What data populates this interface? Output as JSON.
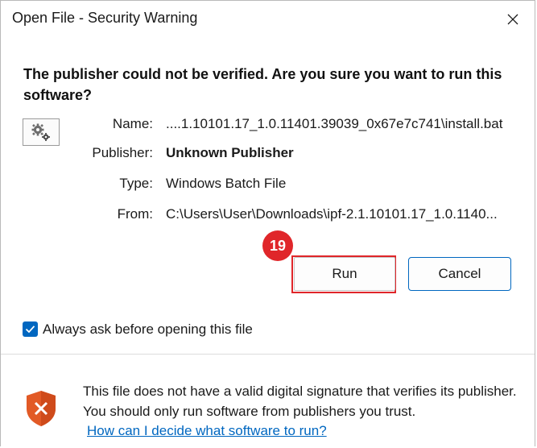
{
  "window": {
    "title": "Open File - Security Warning"
  },
  "warning": {
    "headline": "The publisher could not be verified.  Are you sure you want to run this software?"
  },
  "file_info": {
    "name_label": "Name:",
    "name_value": "....1.10101.17_1.0.11401.39039_0x67e7c741\\install.bat",
    "publisher_label": "Publisher:",
    "publisher_value": "Unknown Publisher",
    "type_label": "Type:",
    "type_value": "Windows Batch File",
    "from_label": "From:",
    "from_value": "C:\\Users\\User\\Downloads\\ipf-2.1.10101.17_1.0.1140..."
  },
  "actions": {
    "run_label": "Run",
    "cancel_label": "Cancel",
    "step_badge": "19"
  },
  "options": {
    "always_ask_label": "Always ask before opening this file",
    "always_ask_checked": true
  },
  "footer": {
    "message": "This file does not have a valid digital signature that verifies its publisher.  You should only run software from publishers you trust.",
    "help_link": "How can I decide what software to run?"
  },
  "icons": {
    "close": "close-icon",
    "file": "settings-file-icon",
    "check": "checkmark-icon",
    "shield": "shield-warning-icon"
  },
  "colors": {
    "accent": "#0067c0",
    "highlight": "#e0262a",
    "shield": "#e25a26"
  }
}
